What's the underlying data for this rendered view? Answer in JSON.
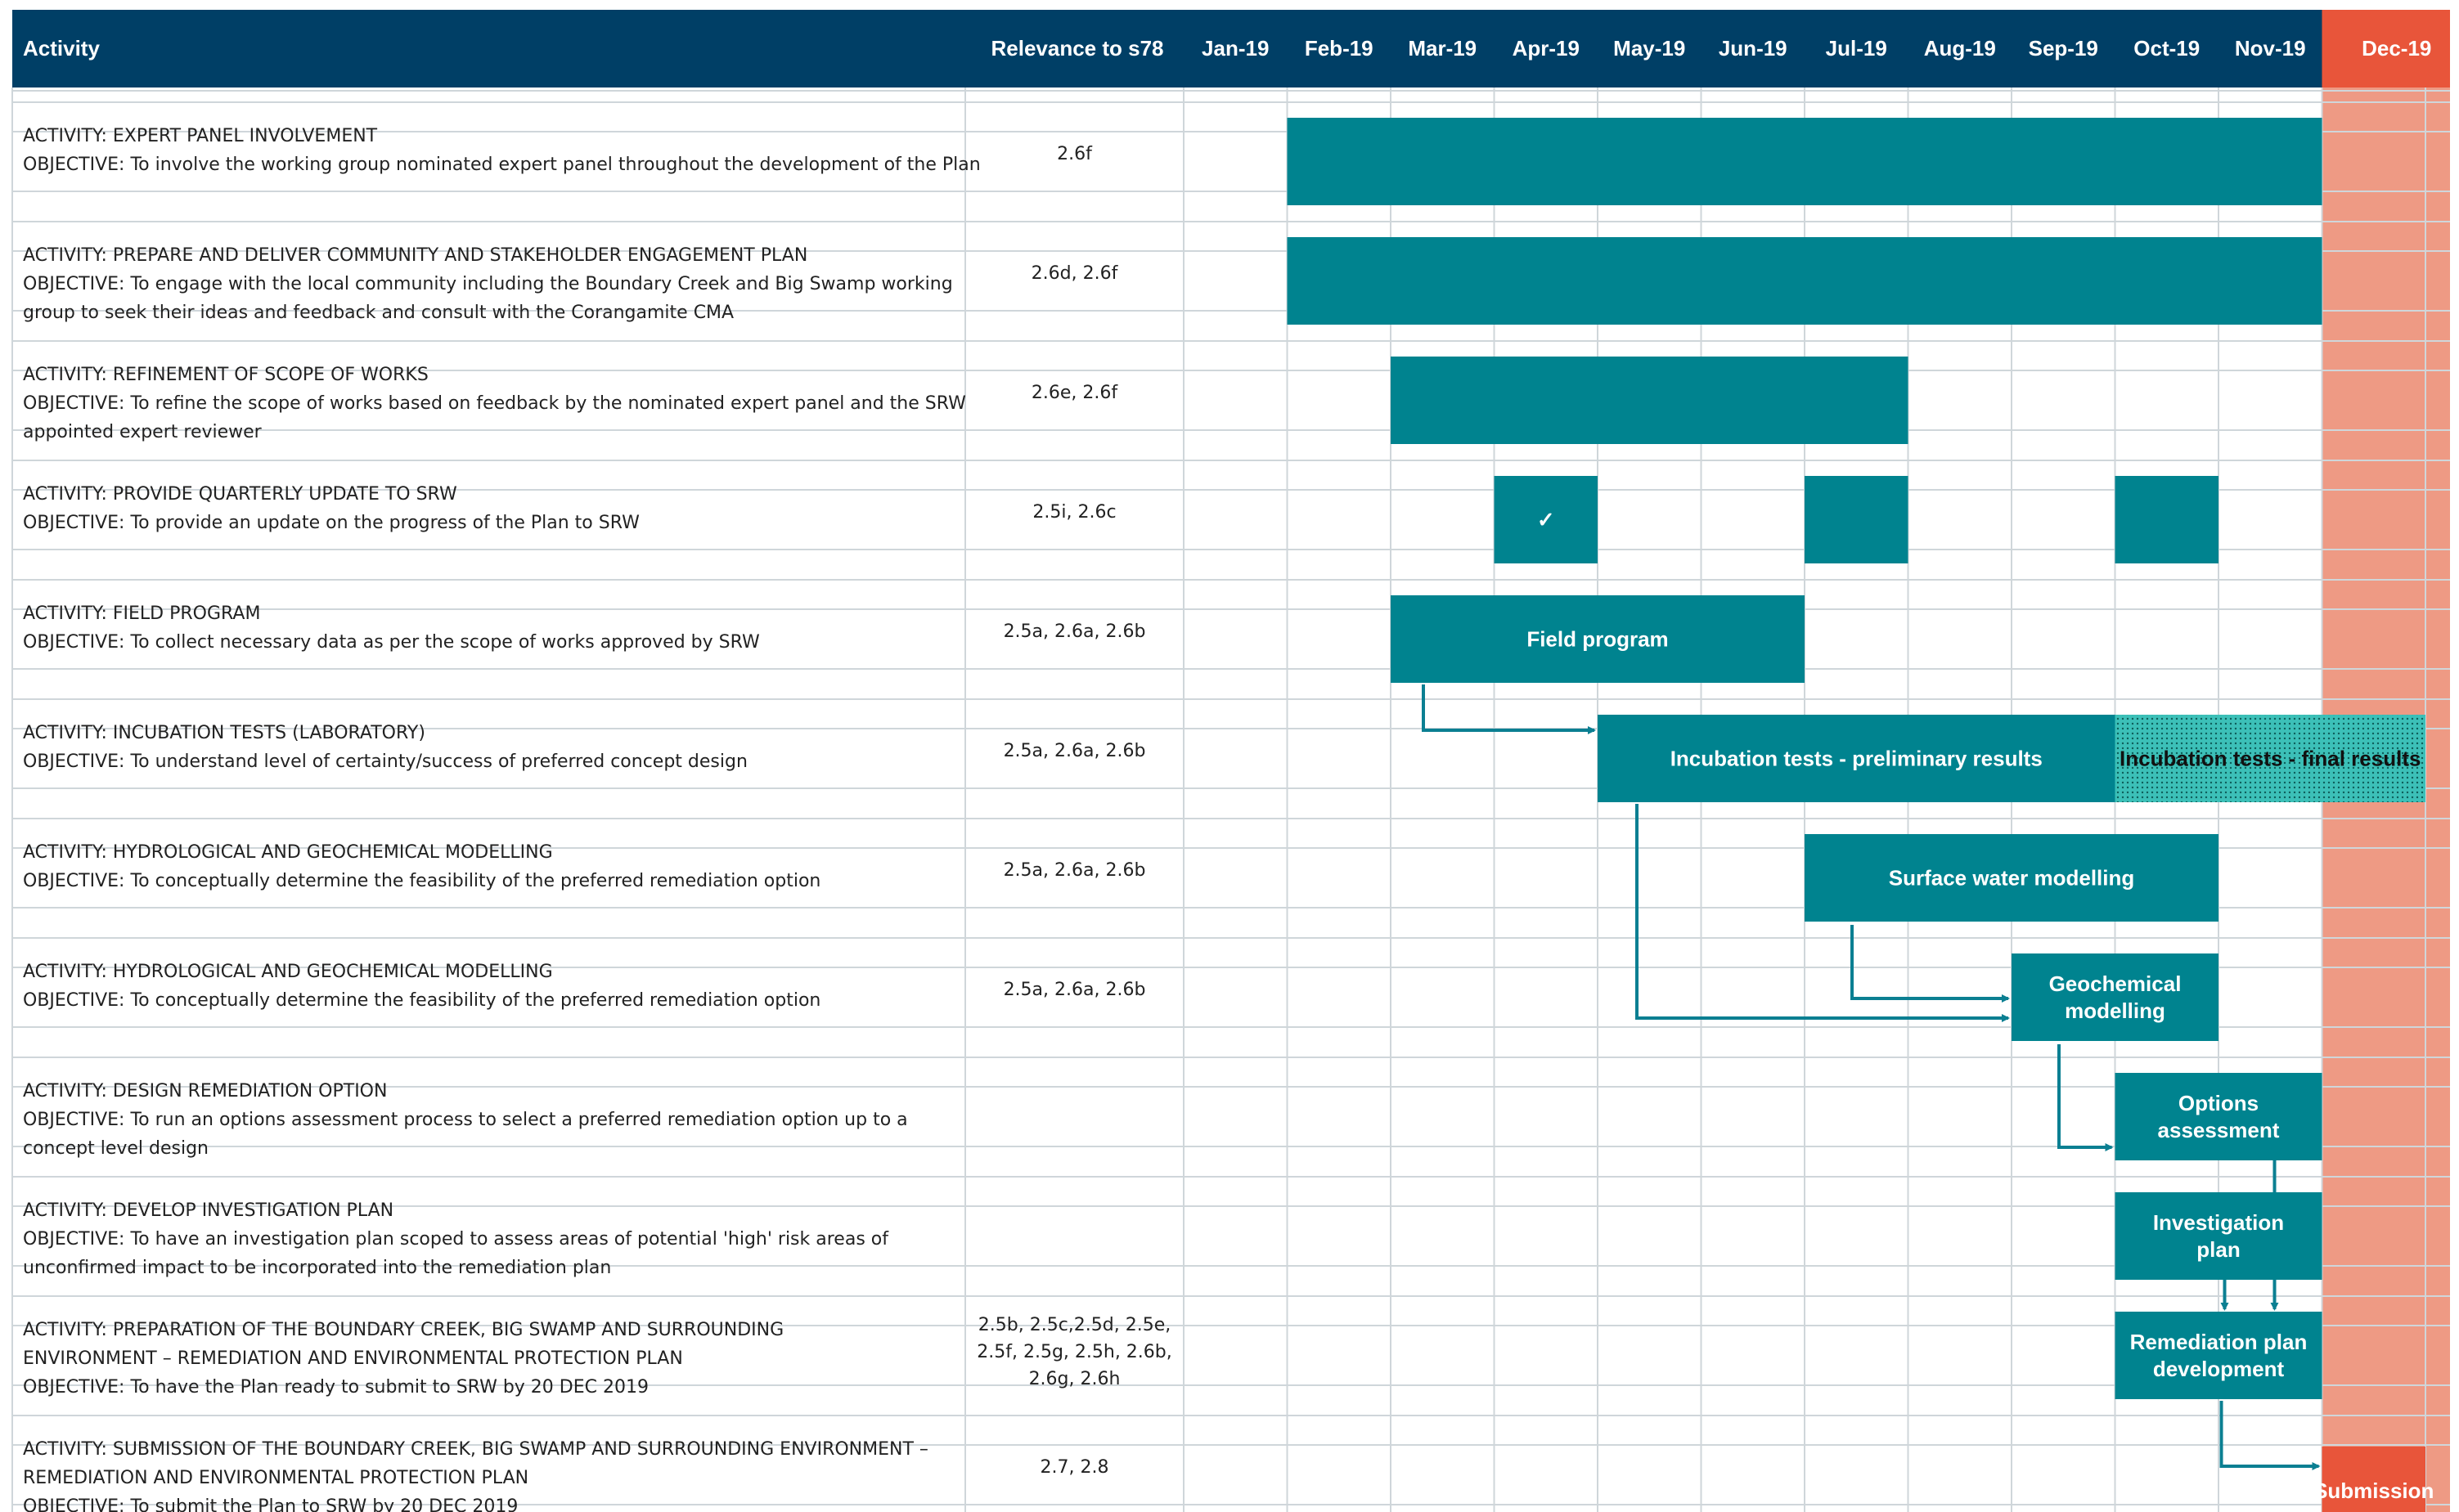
{
  "header": {
    "activity_label": "Activity",
    "relevance_label": "Relevance to s78"
  },
  "colors": {
    "header_bg": "#003f66",
    "bar": "#00838f",
    "deadline_header": "#e8553a",
    "deadline_column": "#ee9a84",
    "arrow": "#0b7f92",
    "grid": "#cfd6da",
    "dotted_bar": "#3cc0b8"
  },
  "chart_data": {
    "type": "gantt",
    "months": [
      "Jan-19",
      "Feb-19",
      "Mar-19",
      "Apr-19",
      "May-19",
      "Jun-19",
      "Jul-19",
      "Aug-19",
      "Sep-19",
      "Oct-19",
      "Nov-19",
      "Dec-19"
    ],
    "deadline_month": "Dec-19",
    "activities": [
      {
        "lines": [
          "ACTIVITY: EXPERT PANEL INVOLVEMENT",
          "OBJECTIVE: To involve the working group nominated expert panel throughout the development of the Plan"
        ],
        "relevance": [
          "2.6f"
        ],
        "bars": [
          {
            "start": 1,
            "end": 11,
            "label": "",
            "style": "solid"
          }
        ]
      },
      {
        "lines": [
          "ACTIVITY: PREPARE AND DELIVER COMMUNITY AND STAKEHOLDER ENGAGEMENT PLAN",
          "OBJECTIVE: To engage with the local community including the Boundary Creek and Big Swamp working",
          "group to seek their ideas and feedback and consult with the Corangamite CMA"
        ],
        "relevance": [
          "2.6d, 2.6f"
        ],
        "bars": [
          {
            "start": 1,
            "end": 11,
            "label": "",
            "style": "solid"
          }
        ]
      },
      {
        "lines": [
          "ACTIVITY: REFINEMENT OF SCOPE OF WORKS",
          "OBJECTIVE: To refine the scope of works based on feedback by the nominated expert panel and the SRW",
          "appointed expert reviewer"
        ],
        "relevance": [
          "2.6e, 2.6f"
        ],
        "bars": [
          {
            "start": 2,
            "end": 7,
            "label": "",
            "style": "solid"
          }
        ]
      },
      {
        "lines": [
          "ACTIVITY: PROVIDE QUARTERLY UPDATE TO SRW",
          "OBJECTIVE: To provide an update on the progress of the Plan to SRW"
        ],
        "relevance": [
          "2.5i, 2.6c"
        ],
        "bars": [
          {
            "start": 3,
            "end": 4,
            "label": "✓",
            "style": "solid"
          },
          {
            "start": 6,
            "end": 7,
            "label": "",
            "style": "solid"
          },
          {
            "start": 9,
            "end": 10,
            "label": "",
            "style": "solid"
          }
        ]
      },
      {
        "lines": [
          "ACTIVITY: FIELD PROGRAM",
          "OBJECTIVE: To collect necessary data as per the scope of works approved by SRW"
        ],
        "relevance": [
          "2.5a, 2.6a, 2.6b"
        ],
        "bars": [
          {
            "start": 2,
            "end": 6,
            "label": "Field program",
            "style": "solid"
          }
        ]
      },
      {
        "lines": [
          "ACTIVITY: INCUBATION TESTS (LABORATORY)",
          "OBJECTIVE: To understand level of certainty/success of preferred concept design"
        ],
        "relevance": [
          "2.5a, 2.6a, 2.6b"
        ],
        "bars": [
          {
            "start": 4,
            "end": 9,
            "label": "Incubation tests - preliminary results",
            "style": "solid"
          },
          {
            "start": 9,
            "end": 12,
            "label": "Incubation tests - final results",
            "style": "dotted"
          }
        ]
      },
      {
        "lines": [
          "ACTIVITY: HYDROLOGICAL AND GEOCHEMICAL MODELLING",
          "OBJECTIVE: To conceptually determine the feasibility of the preferred remediation option"
        ],
        "relevance": [
          "2.5a, 2.6a, 2.6b"
        ],
        "bars": [
          {
            "start": 6,
            "end": 10,
            "label": "Surface water modelling",
            "style": "solid"
          }
        ]
      },
      {
        "lines": [
          "ACTIVITY: HYDROLOGICAL AND GEOCHEMICAL MODELLING",
          "OBJECTIVE: To conceptually determine the feasibility of the preferred remediation option"
        ],
        "relevance": [
          "2.5a, 2.6a, 2.6b"
        ],
        "bars": [
          {
            "start": 8,
            "end": 10,
            "label": "Geochemical|modelling",
            "style": "solid"
          }
        ]
      },
      {
        "lines": [
          "ACTIVITY: DESIGN REMEDIATION OPTION",
          "OBJECTIVE: To run an options assessment process to select a preferred remediation option up to a",
          "concept level design"
        ],
        "relevance": [],
        "bars": [
          {
            "start": 9,
            "end": 11,
            "label": "Options|assessment",
            "style": "solid"
          }
        ]
      },
      {
        "lines": [
          "ACTIVITY: DEVELOP INVESTIGATION PLAN",
          "OBJECTIVE: To have an investigation plan scoped to assess areas of potential 'high' risk areas of",
          "unconfirmed impact to be incorporated into the remediation plan"
        ],
        "relevance": [],
        "bars": [
          {
            "start": 9,
            "end": 11,
            "label": "Investigation|plan",
            "style": "solid"
          }
        ]
      },
      {
        "lines": [
          "ACTIVITY: PREPARATION OF THE BOUNDARY CREEK, BIG SWAMP AND SURROUNDING",
          "ENVIRONMENT – REMEDIATION AND ENVIRONMENTAL PROTECTION PLAN",
          "OBJECTIVE: To have the Plan ready to submit to SRW by 20 DEC 2019"
        ],
        "relevance": [
          "2.5b, 2.5c,2.5d, 2.5e,",
          "2.5f, 2.5g, 2.5h, 2.6b,",
          "2.6g, 2.6h"
        ],
        "bars": [
          {
            "start": 9,
            "end": 11,
            "label": "Remediation plan|development",
            "style": "solid"
          }
        ]
      },
      {
        "lines": [
          "ACTIVITY: SUBMISSION OF THE BOUNDARY CREEK, BIG SWAMP AND SURROUNDING ENVIRONMENT –",
          "REMEDIATION AND ENVIRONMENTAL PROTECTION PLAN",
          "OBJECTIVE: To submit the Plan to SRW by 20 DEC 2019"
        ],
        "relevance": [
          "2.7, 2.8"
        ],
        "bars": [
          {
            "start": 11,
            "end": 12,
            "label": "Submission",
            "style": "deadline"
          }
        ]
      }
    ]
  }
}
